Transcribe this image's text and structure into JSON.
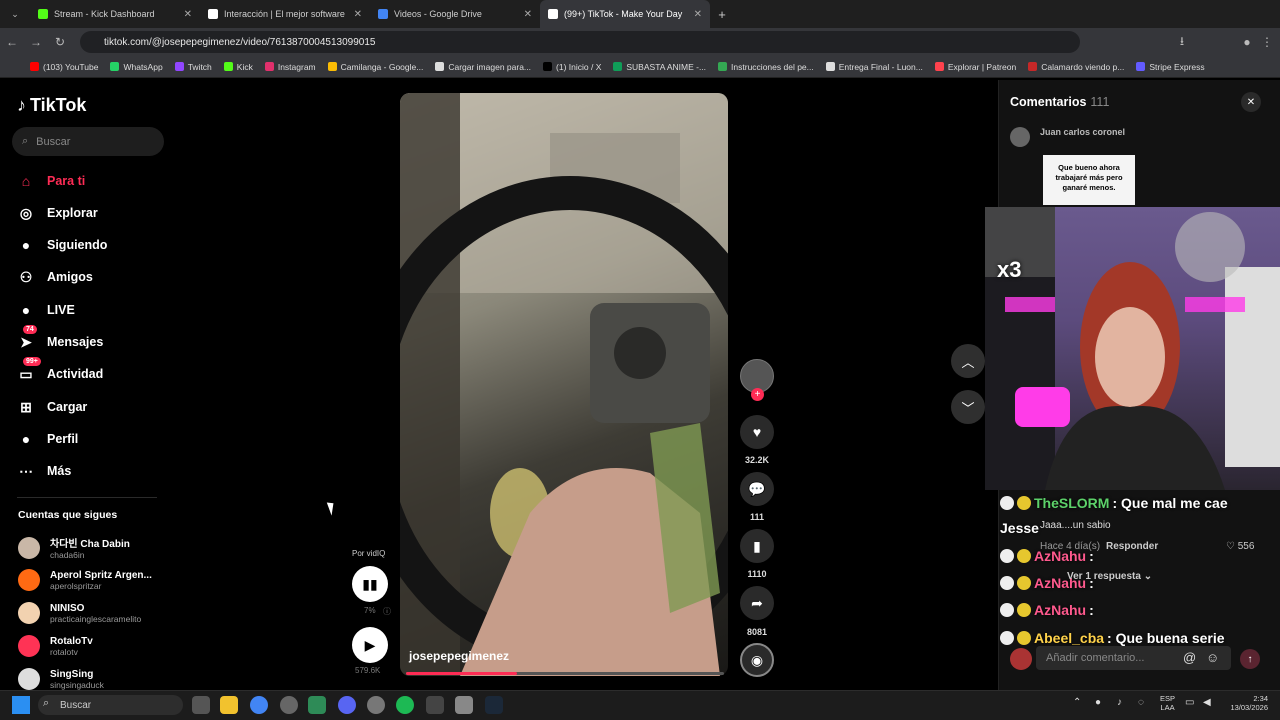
{
  "browser": {
    "tabs": [
      {
        "title": "Stream - Kick Dashboard",
        "color": "#53fc18"
      },
      {
        "title": "Interacción | El mejor software",
        "color": "#ffffff"
      },
      {
        "title": "Videos - Google Drive",
        "color": "#4285f4"
      },
      {
        "title": "(99+) TikTok - Make Your Day",
        "color": "#ffffff"
      }
    ],
    "url": "tiktok.com/@josepepegimenez/video/7613870004513099015",
    "bookmarks": [
      {
        "label": "(103) YouTube",
        "color": "#ff0000"
      },
      {
        "label": "WhatsApp",
        "color": "#25d366"
      },
      {
        "label": "Twitch",
        "color": "#9146ff"
      },
      {
        "label": "Kick",
        "color": "#53fc18"
      },
      {
        "label": "Instagram",
        "color": "#e1306c"
      },
      {
        "label": "Camilanga - Google...",
        "color": "#fbbc04"
      },
      {
        "label": "Cargar imagen para...",
        "color": "#dddddd"
      },
      {
        "label": "(1) Inicio / X",
        "color": "#000000"
      },
      {
        "label": "SUBASTA ANIME -...",
        "color": "#0f9d58"
      },
      {
        "label": "Instrucciones del pe...",
        "color": "#34a853"
      },
      {
        "label": "Entrega Final - Luon...",
        "color": "#dddddd"
      },
      {
        "label": "Explorar | Patreon",
        "color": "#ff424d"
      },
      {
        "label": "Calamardo viendo p...",
        "color": "#c62828"
      },
      {
        "label": "Stripe Express",
        "color": "#635bff"
      }
    ]
  },
  "sidebar": {
    "logo": "TikTok",
    "search_placeholder": "Buscar",
    "nav": [
      {
        "label": "Para ti",
        "icon": "home-icon",
        "glyph": "⌂",
        "badge": ""
      },
      {
        "label": "Explorar",
        "icon": "compass-icon",
        "glyph": "◎",
        "badge": ""
      },
      {
        "label": "Siguiendo",
        "icon": "following-avatar-icon",
        "glyph": "●",
        "badge": ""
      },
      {
        "label": "Amigos",
        "icon": "friends-icon",
        "glyph": "⚇",
        "badge": ""
      },
      {
        "label": "LIVE",
        "icon": "live-icon",
        "glyph": "●",
        "badge": ""
      },
      {
        "label": "Mensajes",
        "icon": "messages-icon",
        "glyph": "➤",
        "badge": "74"
      },
      {
        "label": "Actividad",
        "icon": "activity-icon",
        "glyph": "▭",
        "badge": "99+"
      },
      {
        "label": "Cargar",
        "icon": "upload-icon",
        "glyph": "⊞",
        "badge": ""
      },
      {
        "label": "Perfil",
        "icon": "profile-avatar-icon",
        "glyph": "●",
        "badge": ""
      },
      {
        "label": "Más",
        "icon": "more-icon",
        "glyph": "⋯",
        "badge": ""
      }
    ],
    "following_heading": "Cuentas que sigues",
    "accounts": [
      {
        "name": "차다빈 Cha Dabin",
        "handle": "chada6in",
        "color": "#c9b7a7"
      },
      {
        "name": "Aperol Spritz Argen...",
        "handle": "aperolspritzar",
        "color": "#ff6a13"
      },
      {
        "name": "NINISO",
        "handle": "practicainglescaramelito",
        "color": "#f2d2b0"
      },
      {
        "name": "RotaloTv",
        "handle": "rotalotv",
        "color": "#ff3355"
      },
      {
        "name": "SingSing",
        "handle": "singsingaduck",
        "color": "#dddddd"
      }
    ]
  },
  "video": {
    "username": "josepepegimenez",
    "progress": 0.35,
    "likes": "32.2K",
    "comments": "111",
    "saves": "1110",
    "shares": "8081"
  },
  "vidiq": {
    "label": "Por vidIQ",
    "percent": "7%",
    "views": "579.6K"
  },
  "comments_panel": {
    "title": "Comentarios",
    "count": "111",
    "first_user": "Juan carlos coronel",
    "sticker_text": "Que bueno ahora trabajaré más pero ganaré menos.",
    "reply_meta": "Hace 4 día(s)",
    "reply_action": "Responder",
    "reply_likes": "556",
    "reply_comment": "Jaaa....un sabio",
    "more_replies": "Ver 1 respuesta",
    "input_placeholder": "Añadir comentario..."
  },
  "stream_overlay": {
    "multiplier": "x3",
    "chat": [
      {
        "user": "TheSLORM",
        "message": ": Que mal me cae",
        "color": "green"
      },
      {
        "user": "Jesse",
        "message": "",
        "color": "white"
      },
      {
        "user": "AzNahu",
        "message": ":",
        "color": "pink"
      },
      {
        "user": "AzNahu",
        "message": ":",
        "color": "pink"
      },
      {
        "user": "AzNahu",
        "message": ":",
        "color": "pink"
      },
      {
        "user": "Abeel_cba",
        "message": ": Que buena serie",
        "color": "yellow"
      }
    ]
  },
  "taskbar": {
    "search": "Buscar",
    "lang": "ESP",
    "lang2": "LAA",
    "time": "2:34",
    "date": "13/03/2026"
  }
}
